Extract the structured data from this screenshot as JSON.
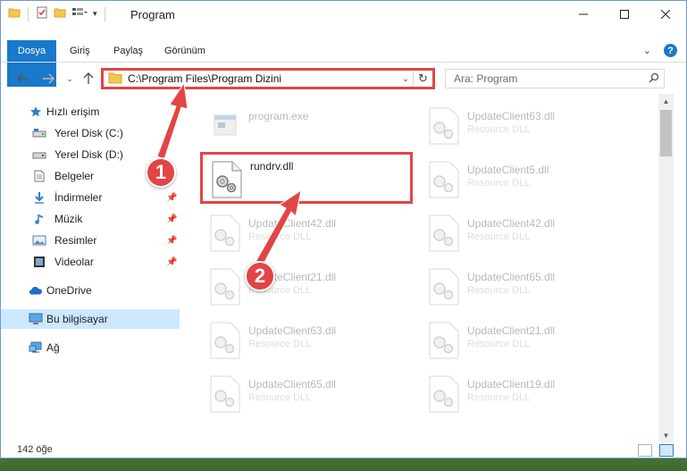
{
  "window": {
    "title": "Program",
    "tabs": [
      "Dosya",
      "Giriş",
      "Paylaş",
      "Görünüm"
    ]
  },
  "address": {
    "path": "C:\\Program Files\\Program Dizini",
    "search_placeholder": "Ara: Program"
  },
  "sidebar": {
    "items": [
      {
        "label": "Hızlı erişim",
        "icon": "star-icon"
      },
      {
        "label": "Yerel Disk (C:)",
        "icon": "drive-icon"
      },
      {
        "label": "Yerel Disk (D:)",
        "icon": "drive-icon"
      },
      {
        "label": "Belgeler",
        "icon": "document-icon"
      },
      {
        "label": "İndirmeler",
        "icon": "download-icon",
        "pinned": true
      },
      {
        "label": "Müzik",
        "icon": "music-icon",
        "pinned": true
      },
      {
        "label": "Resimler",
        "icon": "picture-icon",
        "pinned": true
      },
      {
        "label": "Videolar",
        "icon": "video-icon",
        "pinned": true
      },
      {
        "label": "OneDrive",
        "icon": "cloud-icon"
      },
      {
        "label": "Bu bilgisayar",
        "icon": "computer-icon",
        "selected": true
      },
      {
        "label": "Ağ",
        "icon": "network-icon"
      }
    ]
  },
  "files": {
    "left": [
      {
        "name": "program.exe",
        "desc": ""
      },
      {
        "name": "rundrv.dll",
        "desc": ""
      },
      {
        "name": "UpdateClient42.dll",
        "desc": "Resource DLL"
      },
      {
        "name": "UpdateClient21.dll",
        "desc": "Resource DLL"
      },
      {
        "name": "UpdateClient63.dll",
        "desc": "Resource DLL"
      },
      {
        "name": "UpdateClient65.dll",
        "desc": "Resource DLL"
      }
    ],
    "right": [
      {
        "name": "UpdateClient63.dll",
        "desc": "Resource DLL"
      },
      {
        "name": "UpdateClient5.dll",
        "desc": "Resource DLL"
      },
      {
        "name": "UpdateClient42.dll",
        "desc": "Resource DLL"
      },
      {
        "name": "UpdateClient65.dll",
        "desc": "Resource DLL"
      },
      {
        "name": "UpdateClient21.dll",
        "desc": "Resource DLL"
      },
      {
        "name": "UpdateClient19.dll",
        "desc": "Resource DLL"
      }
    ]
  },
  "status": {
    "item_count": "142 öğe"
  },
  "annotations": {
    "step1": "1",
    "step2": "2",
    "color": "#e24545"
  }
}
